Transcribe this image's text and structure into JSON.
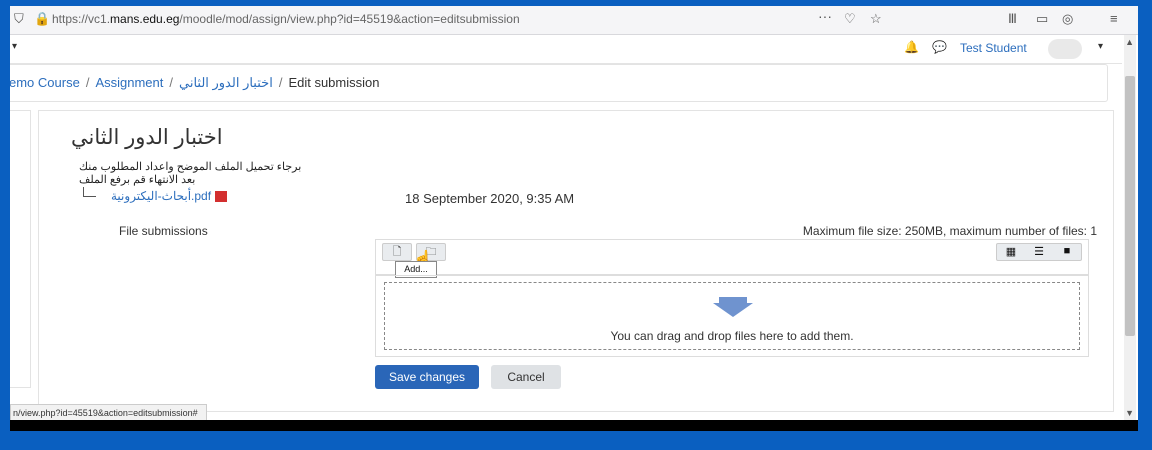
{
  "browser": {
    "url_prefix": "https://vc1.",
    "url_domain": "mans.edu.eg",
    "url_path": "/moodle/mod/assign/view.php?id=45519&action=editsubmission",
    "menu_dots": "···",
    "status_url": "n/view.php?id=45519&action=editsubmission#"
  },
  "header": {
    "user_name": "Test Student"
  },
  "breadcrumb": {
    "course": "emo Course",
    "assignment": "Assignment",
    "activity": "اختبار الدور الثاني",
    "current": "Edit submission"
  },
  "assignment": {
    "title": "اختبار الدور الثاني",
    "intro_line1": "برجاء تحميل الملف الموضح واعداد المطلوب منك",
    "intro_line2": "بعد الانتهاء قم برفع الملف",
    "file_name": "أبحاث-اليكترونية.pdf",
    "file_date": "18 September 2020, 9:35 AM"
  },
  "submission": {
    "label": "File submissions",
    "max_info": "Maximum file size: 250MB, maximum number of files: 1",
    "tooltip": "Add...",
    "dnd_text": "You can drag and drop files here to add them.",
    "save_label": "Save changes",
    "cancel_label": "Cancel"
  },
  "colors": {
    "accent": "#2a66b8",
    "link": "#2c6ebd",
    "outer_background": "#0a5fc0"
  }
}
